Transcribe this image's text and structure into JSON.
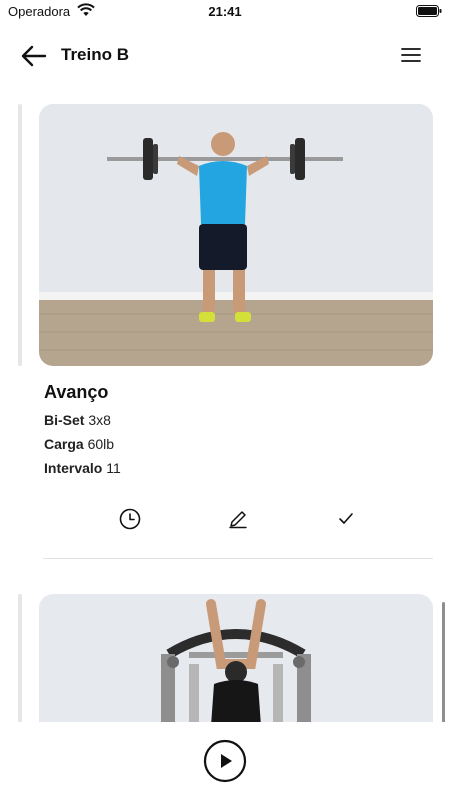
{
  "status_bar": {
    "carrier": "Operadora",
    "time": "21:41",
    "icons": [
      "wifi-icon",
      "battery-icon"
    ]
  },
  "header": {
    "title": "Treino B",
    "icons": [
      "arrow-left-icon",
      "hamburger-menu-icon"
    ]
  },
  "exercises": [
    {
      "name": "Avanço",
      "details": [
        {
          "label": "Bi-Set",
          "value": "3x8"
        },
        {
          "label": "Carga",
          "value": "60lb"
        },
        {
          "label": "Intervalo",
          "value": "11"
        }
      ],
      "actions": [
        "clock-icon",
        "pencil-icon",
        "check-icon"
      ]
    }
  ],
  "footer": {
    "icons": [
      "play-icon"
    ]
  },
  "colors": {
    "background": "#ffffff",
    "text": "#111111",
    "divider": "#e3e3e3",
    "accent_bar": "#e6e6e6"
  }
}
